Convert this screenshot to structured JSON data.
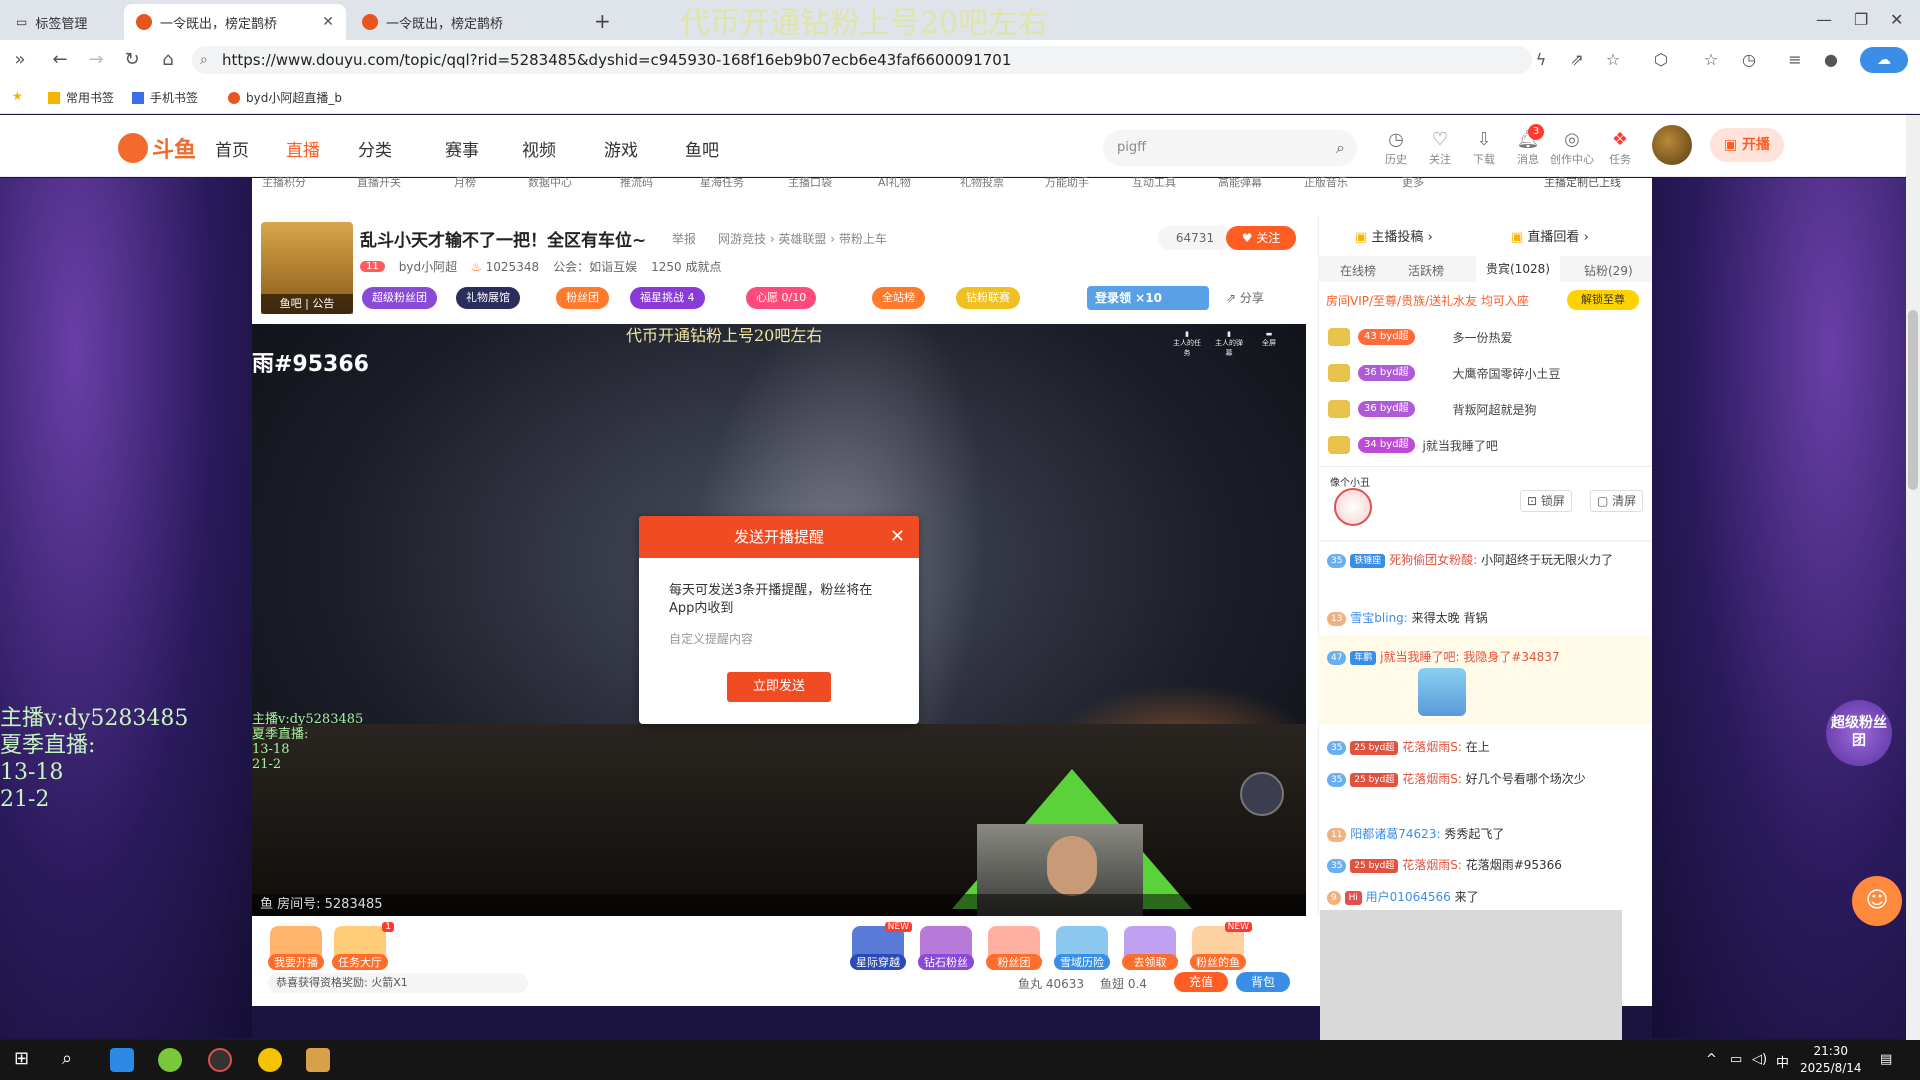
{
  "browser": {
    "tabs": [
      {
        "label": "标签管理"
      },
      {
        "label": "一令既出，榜定鹊桥"
      },
      {
        "label": "一令既出，榜定鹊桥"
      }
    ],
    "overlay_text": "代币开通钻粉上号20吧左右",
    "url": "https://www.douyu.com/topic/qql?rid=5283485&dyshid=c945930-168f16eb9b07ecb6e43faf6600091701",
    "bookmarks": [
      {
        "label": "常用书签"
      },
      {
        "label": "手机书签"
      },
      {
        "label": "byd小阿超直播_b"
      }
    ]
  },
  "header": {
    "logo_text": "斗鱼",
    "nav": [
      {
        "label": "首页"
      },
      {
        "label": "直播"
      },
      {
        "label": "分类"
      },
      {
        "label": "赛事"
      },
      {
        "label": "视频"
      },
      {
        "label": "游戏"
      },
      {
        "label": "鱼吧"
      }
    ],
    "search_value": "pigff",
    "icons": [
      {
        "label": "历史"
      },
      {
        "label": "关注"
      },
      {
        "label": "下载"
      },
      {
        "label": "消息"
      },
      {
        "label": "创作中心"
      },
      {
        "label": "任务"
      }
    ],
    "message_badge": "3",
    "live_button": "开播"
  },
  "toolbar": [
    "主播积分",
    "直播开关",
    "月榜",
    "数据中心",
    "推流码",
    "星海任务",
    "主播口袋",
    "AI礼物",
    "礼物投票",
    "万能助手",
    "互动工具",
    "高能弹幕",
    "正版音乐",
    "更多",
    "主播定制已上线"
  ],
  "room": {
    "avatar_caption": "鱼吧 | 公告",
    "title": "乱斗小天才输不了一把！全区有车位~",
    "report": "举报",
    "category": "网游竞技 › 英雄联盟 › 带粉上车",
    "level": "11",
    "anchor": "byd小阿超",
    "hot": "1025348",
    "guild": "公会：如诣互娱",
    "achievements": "1250 成就点",
    "viewers": "64731",
    "follow": "关注",
    "pills": [
      {
        "label": "超级粉丝团",
        "color": "#8a4ad8"
      },
      {
        "label": "礼物展馆",
        "color": "#2a2e5a"
      },
      {
        "label": "粉丝团",
        "color": "#ff7a2c"
      },
      {
        "label": "福星挑战 4",
        "color": "#8a3ad8"
      },
      {
        "label": "心愿 0/10",
        "color": "#ff4a7a"
      },
      {
        "label": "全站榜",
        "color": "#ff7a2c"
      },
      {
        "label": "钻粉联赛",
        "color": "#f0c020"
      }
    ],
    "login_pill": "登录领 ×10",
    "share": "分享"
  },
  "video": {
    "title": "雨#95366",
    "overlay": "代币开通钻粉上号20吧左右",
    "left_text": [
      "主播v:dy5283485",
      "夏季直播:",
      "13-18",
      "21-2"
    ],
    "bottom": "鱼 房间号: 5283485",
    "icons": [
      "主人的任务",
      "主人的弹幕",
      "全屏"
    ]
  },
  "modal": {
    "title": "发送开播提醒",
    "body": "每天可发送3条开播提醒，粉丝将在App内收到",
    "hint": "自定义提醒内容",
    "button": "立即发送"
  },
  "bottom_bar": {
    "buttons": [
      {
        "label": "我要开播",
        "new": ""
      },
      {
        "label": "任务大厅",
        "new": "1"
      },
      {
        "label": "星际穿越",
        "new": "NEW"
      },
      {
        "label": "钻石粉丝",
        "new": ""
      },
      {
        "label": "粉丝团",
        "new": ""
      },
      {
        "label": "雪域历险",
        "new": ""
      },
      {
        "label": "去领取",
        "new": ""
      },
      {
        "label": "粉丝的鱼",
        "new": "NEW"
      }
    ],
    "reward": "恭喜获得资格奖励: 火箭X1",
    "fish_ball": "鱼丸 40633",
    "fin": "鱼翅 0.4",
    "recharge": "充值",
    "bag": "背包"
  },
  "chat": {
    "top_links": [
      "主播投稿",
      "直播回看"
    ],
    "tabs": [
      "在线榜",
      "活跃榜",
      "贵宾(1028)",
      "钻粉(29)"
    ],
    "vip_line": "房间VIP/至尊/贵族/送礼水友 均可入座",
    "vip_button": "解锁至尊",
    "ranks": [
      {
        "level": "43",
        "name": "byd超",
        "text": "多一份热爱"
      },
      {
        "level": "36",
        "name": "byd超",
        "text": "大鹰帝国零碎小土豆"
      },
      {
        "level": "36",
        "name": "byd超",
        "text": "背叛阿超就是狗"
      },
      {
        "level": "34",
        "name": "byd超",
        "text": "j就当我睡了吧"
      }
    ],
    "lock_screen": "锁屏",
    "clear_screen": "清屏",
    "sticker_caption": "像个小丑",
    "messages": [
      {
        "lv": "35",
        "fan": "铁锤座",
        "nick": "死狗偷团女粉酸:",
        "text": "小阿超终于玩无限火力了"
      },
      {
        "lv": "13",
        "fan": "",
        "nick": "雪宝bling:",
        "text": "来得太晚 背锅"
      },
      {
        "lv": "47",
        "fan": "年鹏",
        "nick": "j就当我睡了吧:",
        "text": "我隐身了#34837"
      },
      {
        "lv": "35",
        "fan": "25 byd超",
        "nick": "花落烟雨S:",
        "text": "在上"
      },
      {
        "lv": "35",
        "fan": "25 byd超",
        "nick": "花落烟雨S:",
        "text": "好几个号看哪个场次少"
      },
      {
        "lv": "11",
        "fan": "",
        "nick": "阳都诸葛74623:",
        "text": "秀秀起飞了"
      },
      {
        "lv": "35",
        "fan": "25 byd超",
        "nick": "花落烟雨S:",
        "text": "花落烟雨#95366"
      },
      {
        "lv": "9",
        "fan": "Hi",
        "nick": "用户01064566",
        "text": "来了"
      }
    ],
    "side_float": "超级粉丝团"
  },
  "taskbar": {
    "ime": "中",
    "time": "21:30",
    "date": "2025/8/14"
  }
}
